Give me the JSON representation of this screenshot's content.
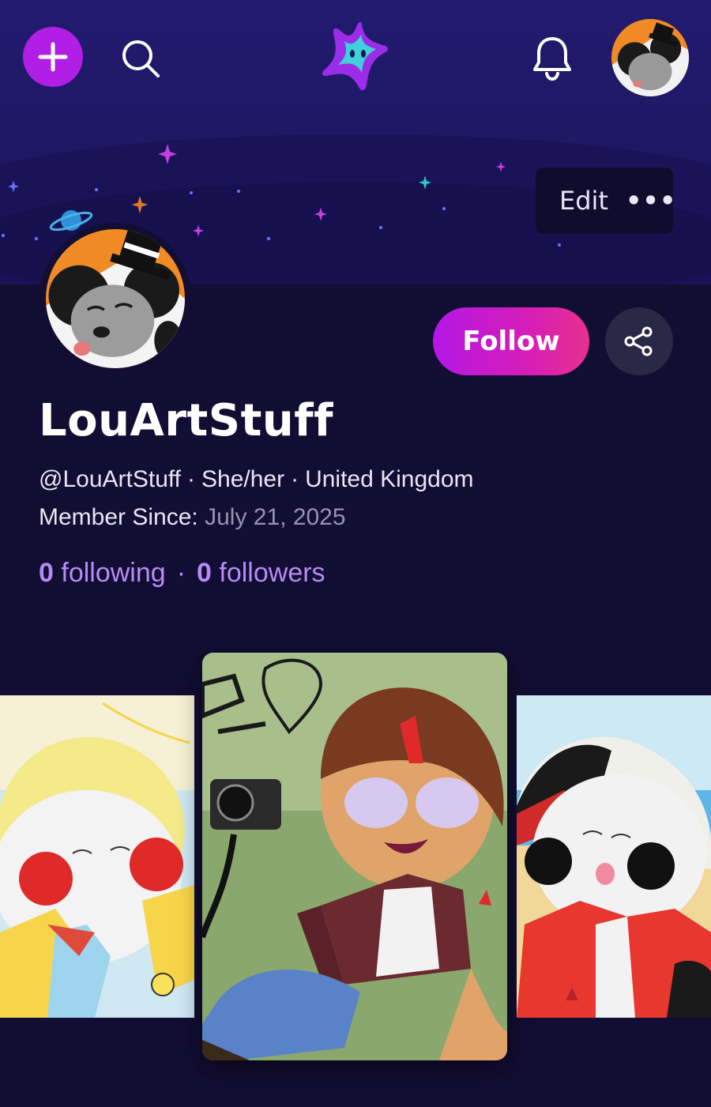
{
  "header": {
    "create_icon": "plus-icon",
    "search_icon": "search-icon",
    "logo_icon": "star-logo-icon",
    "notifications_icon": "bell-icon"
  },
  "banner": {
    "edit_label": "Edit",
    "more_label": "•••"
  },
  "profile": {
    "follow_label": "Follow",
    "share_icon": "share-icon",
    "username": "LouArtStuff",
    "handle": "@LouArtStuff",
    "pronouns": "She/her",
    "location": "United Kingdom",
    "separator": "·",
    "member_since_label": "Member Since:",
    "member_since_date": "July 21, 2025",
    "following_count": "0",
    "following_label": "following",
    "followers_count": "0",
    "followers_label": "followers"
  },
  "colors": {
    "background": "#120d33",
    "banner": "#221a6e",
    "accent_purple": "#b11ee6",
    "follow_gradient_end": "#e8308f",
    "stats_color": "#b58cf5"
  },
  "gallery": {
    "items": [
      {
        "name": "artwork-yellow-hair-character"
      },
      {
        "name": "artwork-camera-character"
      },
      {
        "name": "artwork-red-shirt-character"
      }
    ]
  }
}
